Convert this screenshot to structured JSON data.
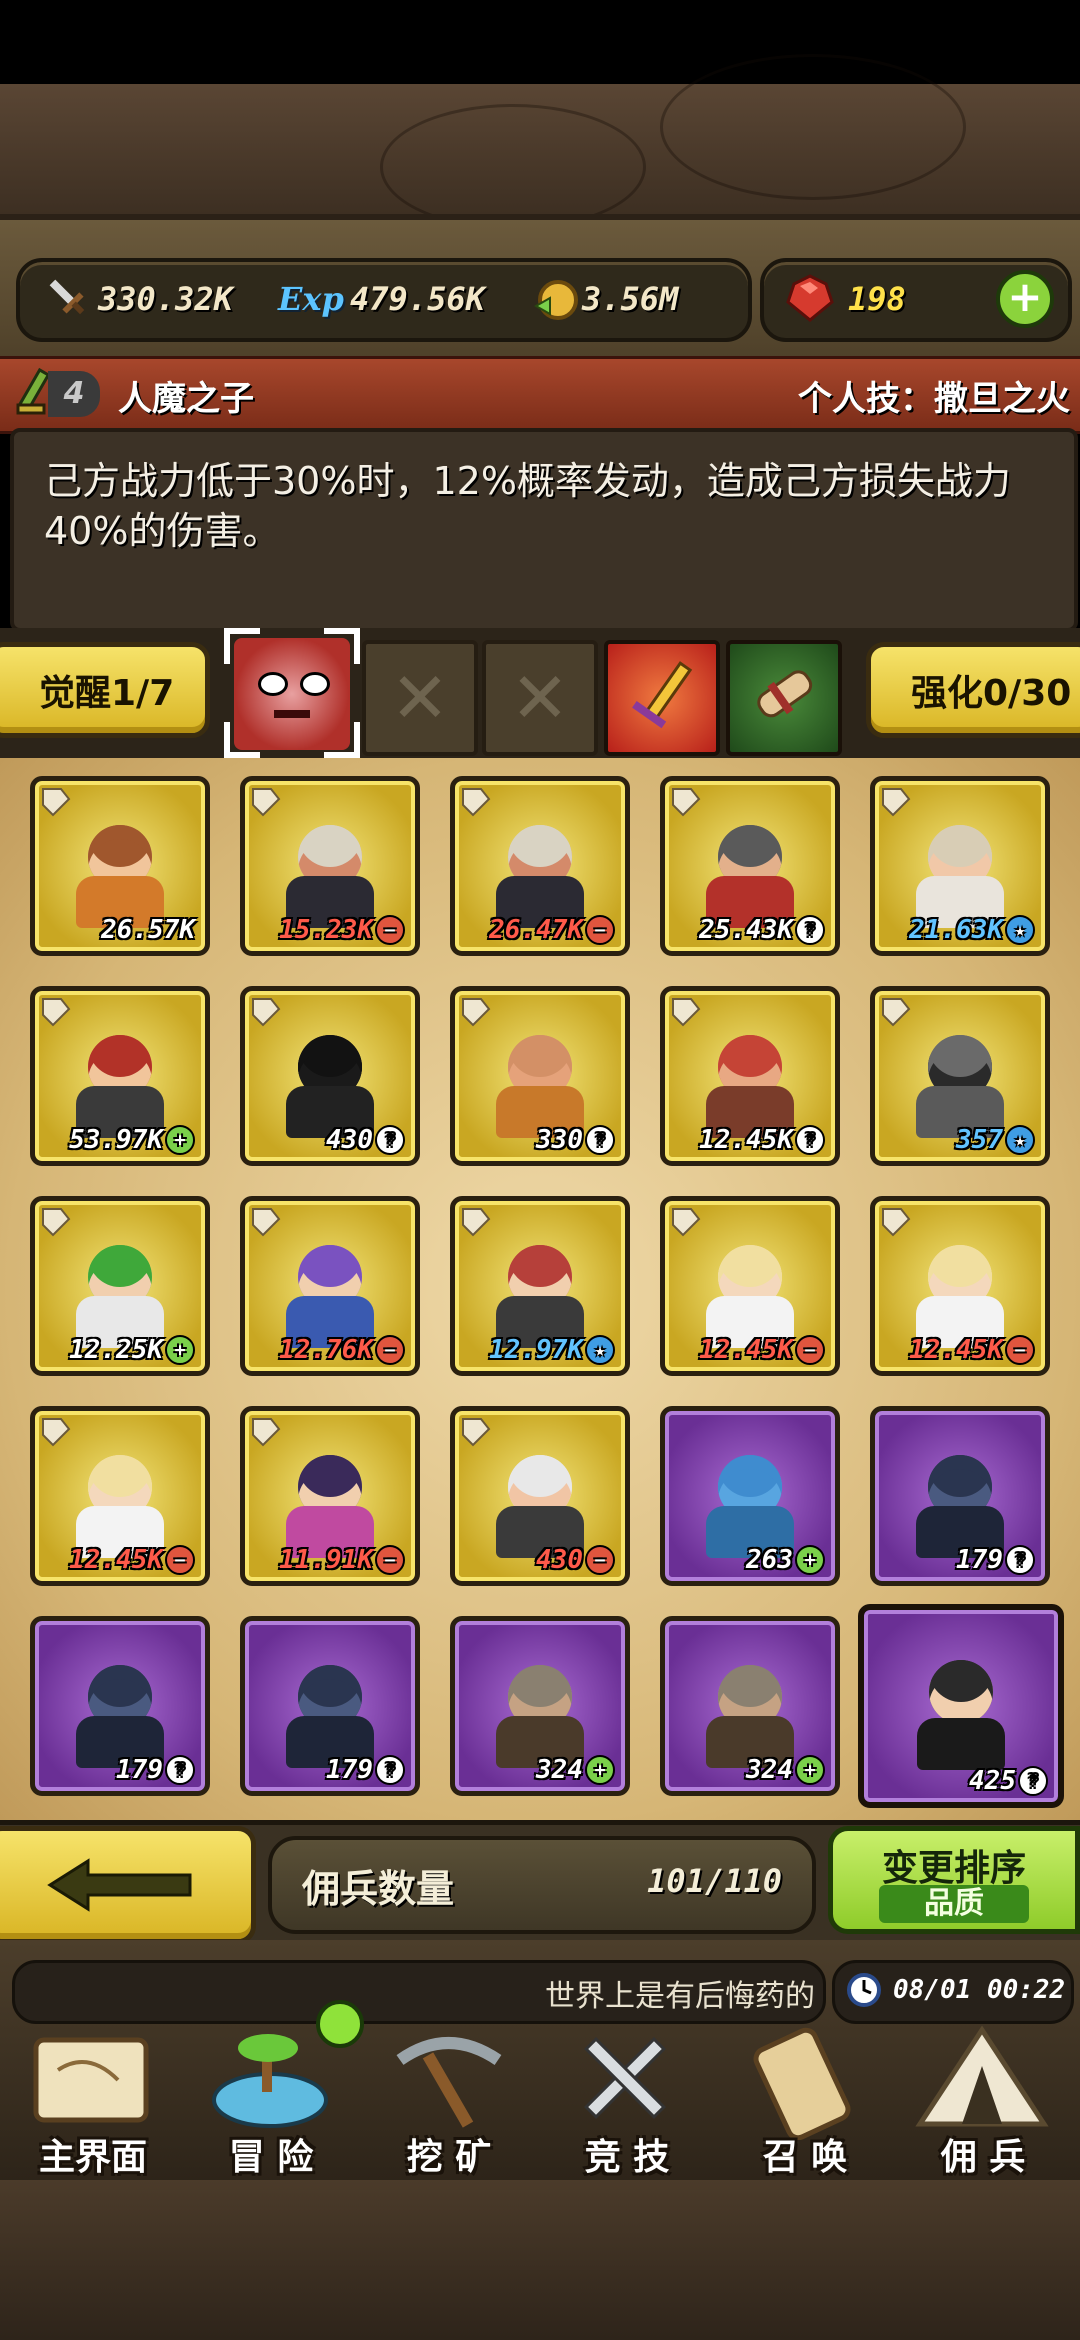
{
  "resources": {
    "attack": "330.32K",
    "exp_icon_text": "Exp",
    "exp": "479.56K",
    "gold": "3.56M",
    "gems": "198"
  },
  "skill": {
    "level": "4",
    "name": "人魔之子",
    "personal_skill": "个人技：撒旦之火",
    "description": "己方战力低于30%时，12%概率发动，造成己方损失战力40%的伤害。"
  },
  "awaken": {
    "label": "觉醒1/7",
    "enhance_label": "强化0/30"
  },
  "mercenaries": [
    {
      "power": "26.57K",
      "badge": "",
      "frame": "gold",
      "hair": "#a0572d",
      "skin": "#f1c59b",
      "cloth": "#d37a2a"
    },
    {
      "power": "15.23K",
      "badge": "minus",
      "frame": "gold",
      "hair": "#d9d3c3",
      "skin": "#d48a6a",
      "cloth": "#2b2a33"
    },
    {
      "power": "26.47K",
      "badge": "minus",
      "frame": "gold",
      "hair": "#d9d3c3",
      "skin": "#d48a6a",
      "cloth": "#2b2a33"
    },
    {
      "power": "25.43K",
      "badge": "q",
      "frame": "gold",
      "hair": "#5a5a5a",
      "skin": "#e3b08b",
      "cloth": "#b3312a"
    },
    {
      "power": "21.63K",
      "badge": "star",
      "frame": "gold",
      "hair": "#d8cdb5",
      "skin": "#f1c8a8",
      "cloth": "#e9e4dc"
    },
    {
      "power": "53.97K",
      "badge": "plus",
      "frame": "gold",
      "hair": "#b23228",
      "skin": "#f1c59b",
      "cloth": "#3a3a3a"
    },
    {
      "power": "430",
      "badge": "q",
      "frame": "gold",
      "hair": "#121212",
      "skin": "#1a1a1a",
      "cloth": "#222"
    },
    {
      "power": "330",
      "badge": "q",
      "frame": "gold",
      "hair": "#d39066",
      "skin": "#e5a27a",
      "cloth": "#c8792a"
    },
    {
      "power": "12.45K",
      "badge": "q",
      "frame": "gold",
      "hair": "#c54436",
      "skin": "#e8a883",
      "cloth": "#7a3c2a"
    },
    {
      "power": "357",
      "badge": "star",
      "frame": "gold",
      "hair": "#6a6a6a",
      "skin": "#2a2a2a",
      "cloth": "#5a5a5a"
    },
    {
      "power": "12.25K",
      "badge": "plus",
      "frame": "gold",
      "hair": "#3fa83a",
      "skin": "#f1cfae",
      "cloth": "#e8e8e8"
    },
    {
      "power": "12.76K",
      "badge": "minus",
      "frame": "gold",
      "hair": "#7a52c0",
      "skin": "#f1cfae",
      "cloth": "#3a5ab0"
    },
    {
      "power": "12.97K",
      "badge": "star",
      "frame": "gold",
      "hair": "#b6403a",
      "skin": "#f1cfae",
      "cloth": "#3a3a3a"
    },
    {
      "power": "12.45K",
      "badge": "minus",
      "frame": "gold",
      "hair": "#f1dfa0",
      "skin": "#f4d8bc",
      "cloth": "#f3f3f3"
    },
    {
      "power": "12.45K",
      "badge": "minus",
      "frame": "gold",
      "hair": "#f1dfa0",
      "skin": "#f4d8bc",
      "cloth": "#f3f3f3"
    },
    {
      "power": "12.45K",
      "badge": "minus",
      "frame": "gold",
      "hair": "#f1dfa0",
      "skin": "#f4d8bc",
      "cloth": "#f3f3f3"
    },
    {
      "power": "11.91K",
      "badge": "minus",
      "frame": "gold",
      "hair": "#3a2a5a",
      "skin": "#f1cfae",
      "cloth": "#c04aa0"
    },
    {
      "power": "430",
      "badge": "minus",
      "frame": "gold",
      "hair": "#e8e8e8",
      "skin": "#f1c5a5",
      "cloth": "#3a3a3a"
    },
    {
      "power": "263",
      "badge": "plus",
      "frame": "purple",
      "hair": "#3f8ccf",
      "skin": "#58a5e0",
      "cloth": "#2e6ea5"
    },
    {
      "power": "179",
      "badge": "q",
      "frame": "purple",
      "hair": "#2a3550",
      "skin": "#4a5a80",
      "cloth": "#1e2538"
    },
    {
      "power": "179",
      "badge": "q",
      "frame": "purple",
      "hair": "#2a3550",
      "skin": "#4a5a80",
      "cloth": "#1e2538"
    },
    {
      "power": "179",
      "badge": "q",
      "frame": "purple",
      "hair": "#2a3550",
      "skin": "#4a5a80",
      "cloth": "#1e2538"
    },
    {
      "power": "324",
      "badge": "plus",
      "frame": "purple",
      "hair": "#8a8070",
      "skin": "#c5a283",
      "cloth": "#4a3a2a"
    },
    {
      "power": "324",
      "badge": "plus",
      "frame": "purple",
      "hair": "#8a8070",
      "skin": "#c5a283",
      "cloth": "#4a3a2a"
    },
    {
      "power": "425",
      "badge": "q",
      "frame": "purple",
      "hair": "#2a2a2a",
      "skin": "#f1cfae",
      "cloth": "#1a1a1a",
      "selected": true
    }
  ],
  "mercenary_count": {
    "label": "佣兵数量",
    "value": "101/110"
  },
  "sort": {
    "label": "变更排序",
    "mode": "品质"
  },
  "marquee": "世界上是有后悔药的",
  "clock": "08/01 00:22",
  "nav": [
    {
      "label": "主界面",
      "icon": "map-scroll-icon"
    },
    {
      "label": "冒 险",
      "icon": "island-icon"
    },
    {
      "label": "挖 矿",
      "icon": "pickaxe-icon"
    },
    {
      "label": "竞 技",
      "icon": "crossed-swords-icon"
    },
    {
      "label": "召 唤",
      "icon": "summon-scroll-icon"
    },
    {
      "label": "佣 兵",
      "icon": "tent-icon"
    }
  ],
  "colors": {
    "gold_frame": "#e9cf45",
    "purple_frame": "#8b4cbf",
    "accent_green": "#9fe13a",
    "gem_red": "#d63a2e"
  }
}
